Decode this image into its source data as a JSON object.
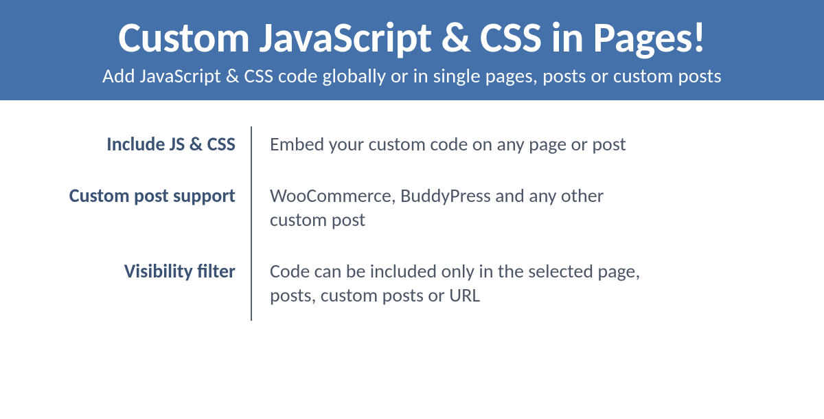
{
  "header": {
    "title": "Custom JavaScript & CSS in Pages!",
    "subtitle": "Add JavaScript & CSS code globally or in single pages, posts or custom posts"
  },
  "features": [
    {
      "label": "Include JS & CSS",
      "desc": "Embed your custom code on any page or post"
    },
    {
      "label": "Custom post support",
      "desc": "WooCommerce, BuddyPress and any other custom post"
    },
    {
      "label": "Visibility filter",
      "desc": "Code can be included only in the selected page, posts, custom posts or URL"
    }
  ]
}
